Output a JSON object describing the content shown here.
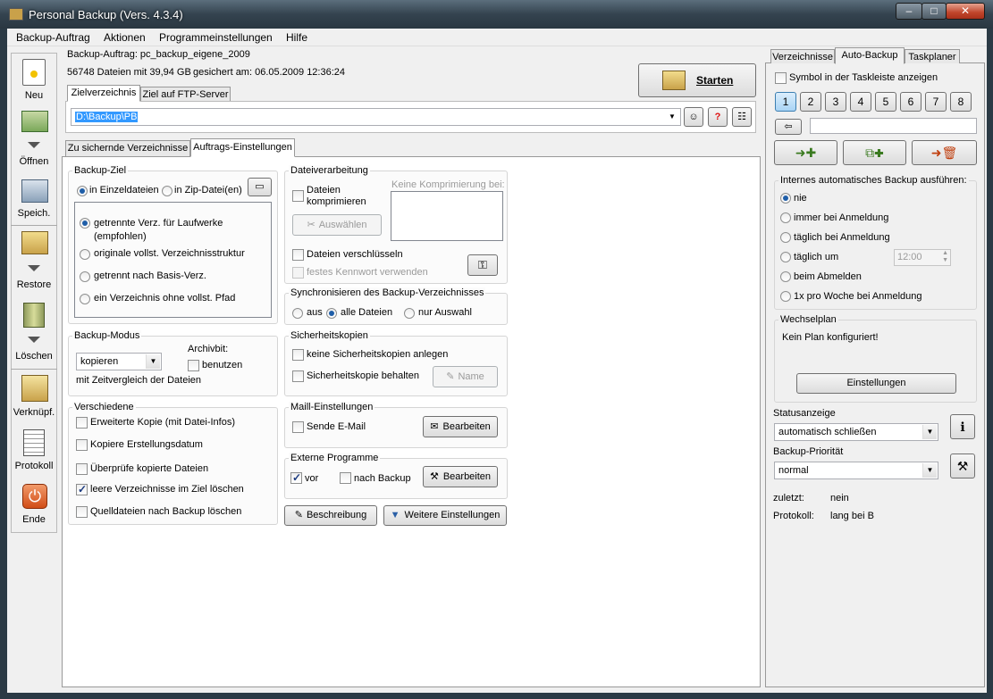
{
  "window": {
    "title": "Personal Backup (Vers. 4.3.4)",
    "min": "–",
    "max": "□",
    "close": "✕"
  },
  "menu": [
    "Backup-Auftrag",
    "Aktionen",
    "Programmeinstellungen",
    "Hilfe"
  ],
  "toolbar": [
    {
      "label": "Neu",
      "icon": "new-document-icon"
    },
    {
      "label": "Öffnen",
      "icon": "open-icon"
    },
    {
      "label": "Speich.",
      "icon": "save-icon"
    },
    {
      "label": "Restore",
      "icon": "restore-icon"
    },
    {
      "label": "Löschen",
      "icon": "delete-icon"
    },
    {
      "label": "Verknüpf.",
      "icon": "shortcut-icon"
    },
    {
      "label": "Protokoll",
      "icon": "log-icon"
    },
    {
      "label": "Ende",
      "icon": "power-icon"
    }
  ],
  "job": {
    "name_line": "Backup-Auftrag: pc_backup_eigene_2009",
    "files_line": "56748 Dateien mit 39,94 GB",
    "saved_line": "gesichert am:  06.05.2009 12:36:24",
    "start_button": "Starten"
  },
  "target_tabs": [
    "Zielverzeichnis",
    "Ziel auf FTP-Server"
  ],
  "target_path": "D:\\Backup\\PB",
  "main_tabs": [
    "Zu sichernde Verzeichnisse",
    "Auftrags-Einstellungen"
  ],
  "backup_ziel": {
    "title": "Backup-Ziel",
    "opt_einzeln": "in Einzeldateien",
    "opt_zip": "in Zip-Datei(en)",
    "options": [
      "getrennte Verz. für Laufwerke (empfohlen)",
      "originale vollst. Verzeichnisstruktur",
      "getrennt nach Basis-Verz.",
      "ein Verzeichnis ohne vollst. Pfad"
    ]
  },
  "backup_modus": {
    "title": "Backup-Modus",
    "mode": "kopieren",
    "archivbit": "Archivbit:",
    "benutzen": "benutzen",
    "info": "mit Zeitvergleich der Dateien"
  },
  "verschiedene": {
    "title": "Verschiedene",
    "items": [
      {
        "label": "Erweiterte Kopie (mit Datei-Infos)",
        "checked": false
      },
      {
        "label": "Kopiere Erstellungsdatum",
        "checked": false
      },
      {
        "label": "Überprüfe kopierte Dateien",
        "checked": false
      },
      {
        "label": "leere Verzeichnisse im Ziel löschen",
        "checked": true
      },
      {
        "label": "Quelldateien nach Backup löschen",
        "checked": false
      }
    ]
  },
  "dateiverarbeitung": {
    "title": "Dateiverarbeitung",
    "komprimieren": "Dateien komprimieren",
    "keine_kompr": "Keine Komprimierung bei:",
    "auswaehlen": "Auswählen",
    "verschluesseln": "Dateien verschlüsseln",
    "kennwort": "festes Kennwort verwenden"
  },
  "sync": {
    "title": "Synchronisieren des Backup-Verzeichnisses",
    "options": [
      "aus",
      "alle Dateien",
      "nur Auswahl"
    ]
  },
  "sicherheit": {
    "title": "Sicherheitskopien",
    "keine": "keine Sicherheitskopien anlegen",
    "behalten": "Sicherheitskopie behalten",
    "name_btn": "Name"
  },
  "mail": {
    "title": "Maill-Einstellungen",
    "send": "Sende E-Mail",
    "edit": "Bearbeiten"
  },
  "extern": {
    "title": "Externe Programme",
    "vor": "vor",
    "nach": "nach Backup",
    "edit": "Bearbeiten"
  },
  "bottom_buttons": {
    "beschreibung": "Beschreibung",
    "weitere": "Weitere Einstellungen"
  },
  "right_tabs": [
    "Verzeichnisse",
    "Auto-Backup",
    "Taskplaner"
  ],
  "auto": {
    "taskbar": "Symbol in der Taskleiste anzeigen",
    "numbers": [
      "1",
      "2",
      "3",
      "4",
      "5",
      "6",
      "7",
      "8"
    ],
    "internal_title": "Internes automatisches Backup ausführen:",
    "options": [
      "nie",
      "immer bei Anmeldung",
      "täglich bei Anmeldung",
      "täglich um",
      "beim Abmelden",
      "1x pro Woche bei Anmeldung"
    ],
    "time": "12:00",
    "wechsel_title": "Wechselplan",
    "wechsel_text": "Kein Plan konfiguriert!",
    "einstellungen": "Einstellungen",
    "status_label": "Statusanzeige",
    "status_value": "automatisch schließen",
    "prio_label": "Backup-Priorität",
    "prio_value": "normal",
    "zuletzt_label": "zuletzt:",
    "zuletzt_value": "nein",
    "protokoll_label": "Protokoll:",
    "protokoll_value": "lang bei B"
  }
}
